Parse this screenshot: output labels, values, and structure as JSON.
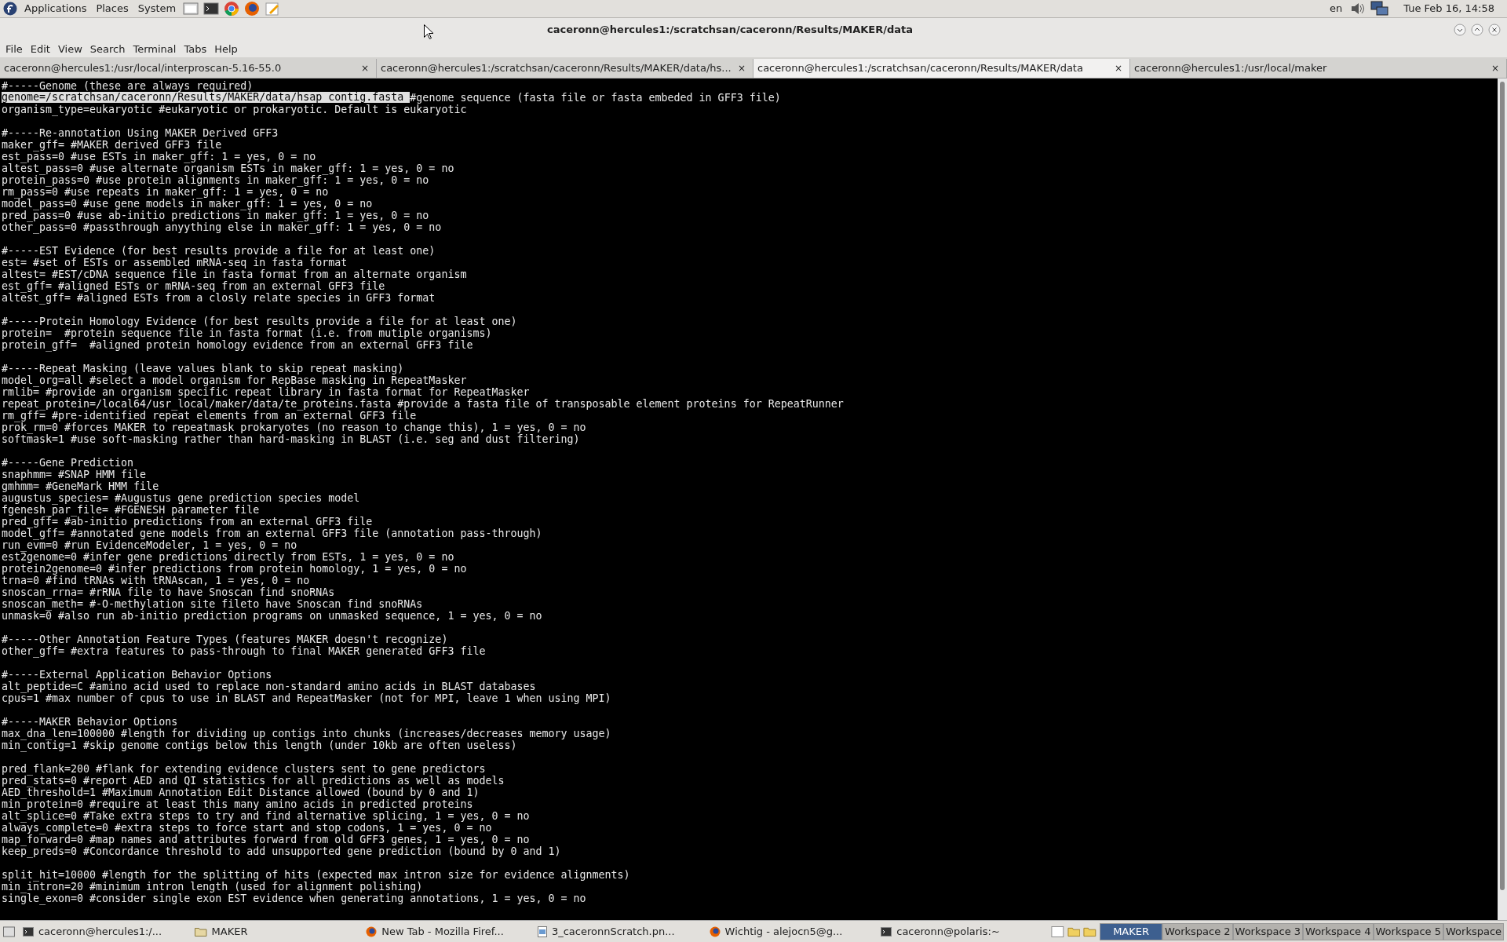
{
  "top_panel": {
    "menus": [
      "Applications",
      "Places",
      "System"
    ],
    "keyboard_layout": "en",
    "clock": "Tue Feb 16, 14:58"
  },
  "window": {
    "title": "caceronn@hercules1:/scratchsan/caceronn/Results/MAKER/data"
  },
  "menu_bar": [
    "File",
    "Edit",
    "View",
    "Search",
    "Terminal",
    "Tabs",
    "Help"
  ],
  "tabs": [
    {
      "label": "caceronn@hercules1:/usr/local/interproscan-5.16-55.0",
      "close": "×",
      "selected": false
    },
    {
      "label": "caceronn@hercules1:/scratchsan/caceronn/Results/MAKER/data/hs...",
      "close": "×",
      "selected": false
    },
    {
      "label": "caceronn@hercules1:/scratchsan/caceronn/Results/MAKER/data",
      "close": "×",
      "selected": true
    },
    {
      "label": "caceronn@hercules1:/usr/local/maker",
      "close": "×",
      "selected": false
    }
  ],
  "terminal": {
    "blocks": [
      [
        {
          "text": "#-----Genome (these are always required)"
        },
        {
          "selection": "genome=/scratchsan/caceronn/Results/MAKER/data/hsap_contig.fasta ",
          "text": "#genome sequence (fasta file or fasta embeded in GFF3 file)"
        },
        {
          "text": "organism_type=eukaryotic #eukaryotic or prokaryotic. Default is eukaryotic"
        }
      ],
      [
        {
          "text": "#-----Re-annotation Using MAKER Derived GFF3"
        },
        {
          "text": "maker_gff= #MAKER derived GFF3 file"
        },
        {
          "text": "est_pass=0 #use ESTs in maker_gff: 1 = yes, 0 = no"
        },
        {
          "text": "altest_pass=0 #use alternate organism ESTs in maker_gff: 1 = yes, 0 = no"
        },
        {
          "text": "protein_pass=0 #use protein alignments in maker_gff: 1 = yes, 0 = no"
        },
        {
          "text": "rm_pass=0 #use repeats in maker_gff: 1 = yes, 0 = no"
        },
        {
          "text": "model_pass=0 #use gene models in maker_gff: 1 = yes, 0 = no"
        },
        {
          "text": "pred_pass=0 #use ab-initio predictions in maker_gff: 1 = yes, 0 = no"
        },
        {
          "text": "other_pass=0 #passthrough anyything else in maker_gff: 1 = yes, 0 = no"
        }
      ],
      [
        {
          "text": "#-----EST Evidence (for best results provide a file for at least one)"
        },
        {
          "text": "est= #set of ESTs or assembled mRNA-seq in fasta format"
        },
        {
          "text": "altest= #EST/cDNA sequence file in fasta format from an alternate organism"
        },
        {
          "text": "est_gff= #aligned ESTs or mRNA-seq from an external GFF3 file"
        },
        {
          "text": "altest_gff= #aligned ESTs from a closly relate species in GFF3 format"
        }
      ],
      [
        {
          "text": "#-----Protein Homology Evidence (for best results provide a file for at least one)"
        },
        {
          "text": "protein=  #protein sequence file in fasta format (i.e. from mutiple organisms)"
        },
        {
          "text": "protein_gff=  #aligned protein homology evidence from an external GFF3 file"
        }
      ],
      [
        {
          "text": "#-----Repeat Masking (leave values blank to skip repeat masking)"
        },
        {
          "text": "model_org=all #select a model organism for RepBase masking in RepeatMasker"
        },
        {
          "text": "rmlib= #provide an organism specific repeat library in fasta format for RepeatMasker"
        },
        {
          "text": "repeat_protein=/local64/usr_local/maker/data/te_proteins.fasta #provide a fasta file of transposable element proteins for RepeatRunner"
        },
        {
          "text": "rm_gff= #pre-identified repeat elements from an external GFF3 file"
        },
        {
          "text": "prok_rm=0 #forces MAKER to repeatmask prokaryotes (no reason to change this), 1 = yes, 0 = no"
        },
        {
          "text": "softmask=1 #use soft-masking rather than hard-masking in BLAST (i.e. seg and dust filtering)"
        }
      ],
      [
        {
          "text": "#-----Gene Prediction"
        },
        {
          "text": "snaphmm= #SNAP HMM file"
        },
        {
          "text": "gmhmm= #GeneMark HMM file"
        },
        {
          "text": "augustus_species= #Augustus gene prediction species model"
        },
        {
          "text": "fgenesh_par_file= #FGENESH parameter file"
        },
        {
          "text": "pred_gff= #ab-initio predictions from an external GFF3 file"
        },
        {
          "text": "model_gff= #annotated gene models from an external GFF3 file (annotation pass-through)"
        },
        {
          "text": "run_evm=0 #run EvidenceModeler, 1 = yes, 0 = no"
        },
        {
          "text": "est2genome=0 #infer gene predictions directly from ESTs, 1 = yes, 0 = no"
        },
        {
          "text": "protein2genome=0 #infer predictions from protein homology, 1 = yes, 0 = no"
        },
        {
          "text": "trna=0 #find tRNAs with tRNAscan, 1 = yes, 0 = no"
        },
        {
          "text": "snoscan_rrna= #rRNA file to have Snoscan find snoRNAs"
        },
        {
          "text": "snoscan_meth= #-O-methylation site fileto have Snoscan find snoRNAs"
        },
        {
          "text": "unmask=0 #also run ab-initio prediction programs on unmasked sequence, 1 = yes, 0 = no"
        }
      ],
      [
        {
          "text": "#-----Other Annotation Feature Types (features MAKER doesn't recognize)"
        },
        {
          "text": "other_gff= #extra features to pass-through to final MAKER generated GFF3 file"
        }
      ],
      [
        {
          "text": "#-----External Application Behavior Options"
        },
        {
          "text": "alt_peptide=C #amino acid used to replace non-standard amino acids in BLAST databases"
        },
        {
          "text": "cpus=1 #max number of cpus to use in BLAST and RepeatMasker (not for MPI, leave 1 when using MPI)"
        }
      ],
      [
        {
          "text": "#-----MAKER Behavior Options"
        },
        {
          "text": "max_dna_len=100000 #length for dividing up contigs into chunks (increases/decreases memory usage)"
        },
        {
          "text": "min_contig=1 #skip genome contigs below this length (under 10kb are often useless)"
        }
      ],
      [
        {
          "text": "pred_flank=200 #flank for extending evidence clusters sent to gene predictors"
        },
        {
          "text": "pred_stats=0 #report AED and QI statistics for all predictions as well as models"
        },
        {
          "text": "AED_threshold=1 #Maximum Annotation Edit Distance allowed (bound by 0 and 1)"
        },
        {
          "text": "min_protein=0 #require at least this many amino acids in predicted proteins"
        },
        {
          "text": "alt_splice=0 #Take extra steps to try and find alternative splicing, 1 = yes, 0 = no"
        },
        {
          "text": "always_complete=0 #extra steps to force start and stop codons, 1 = yes, 0 = no"
        },
        {
          "text": "map_forward=0 #map names and attributes forward from old GFF3 genes, 1 = yes, 0 = no"
        },
        {
          "text": "keep_preds=0 #Concordance threshold to add unsupported gene prediction (bound by 0 and 1)"
        }
      ],
      [
        {
          "text": "split_hit=10000 #length for the splitting of hits (expected max intron size for evidence alignments)"
        },
        {
          "text": "min_intron=20 #minimum intron length (used for alignment polishing)"
        },
        {
          "text": "single_exon=0 #consider single exon EST evidence when generating annotations, 1 = yes, 0 = no"
        }
      ]
    ]
  },
  "taskbar": {
    "items": [
      {
        "label": "caceronn@hercules1:/...",
        "kind": "terminal"
      },
      {
        "label": "MAKER",
        "kind": "folder"
      },
      {
        "label": "New Tab - Mozilla Firef...",
        "kind": "browser"
      },
      {
        "label": "3_caceronnScratch.pn...",
        "kind": "image"
      },
      {
        "label": "Wichtig - alejocn5@g...",
        "kind": "browser"
      },
      {
        "label": "caceronn@polaris:~",
        "kind": "terminal"
      }
    ],
    "workspaces": [
      {
        "label": "MAKER",
        "selected": true
      },
      {
        "label": "Workspace 2",
        "selected": false
      },
      {
        "label": "Workspace 3",
        "selected": false
      },
      {
        "label": "Workspace 4",
        "selected": false
      },
      {
        "label": "Workspace 5",
        "selected": false
      },
      {
        "label": "Workspace",
        "selected": false
      }
    ]
  }
}
